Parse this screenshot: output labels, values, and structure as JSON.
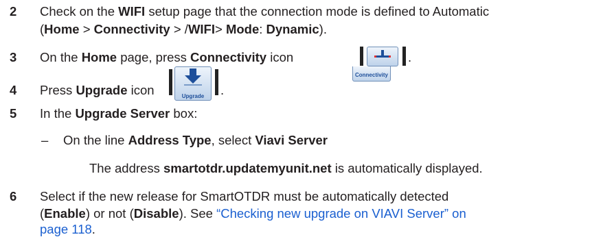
{
  "steps": [
    {
      "num": "2",
      "lines": [
        {
          "t1": "Check on the ",
          "b1": "WIFI",
          "t2": " setup page that the connection mode is defined to Automatic"
        },
        {
          "t1": "(",
          "b1": "Home",
          "t2": " > ",
          "b2": "Connectivity",
          "t3": " > /",
          "b3": "WIFI",
          "t4": "> ",
          "b4": "Mode",
          "t5": ": ",
          "b5": "Dynamic",
          "t6": ")."
        }
      ]
    },
    {
      "num": "3",
      "t1": "On the ",
      "b1": "Home",
      "t2": " page, press ",
      "b2": "Connectivity",
      "t3": " icon",
      "tail": "."
    },
    {
      "num": "4",
      "t1": "Press ",
      "b1": "Upgrade",
      "t2": " icon",
      "tail": "."
    },
    {
      "num": "5",
      "t1": "In the ",
      "b1": "Upgrade Server",
      "t2": " box:"
    },
    {
      "dash": "–",
      "t1": "On the line ",
      "b1": "Address Type",
      "t2": ", select ",
      "b2": "Viavi Server"
    },
    {
      "t1": "The address ",
      "b1": "smartotdr.updatemyunit.net",
      "t2": " is automatically displayed."
    },
    {
      "num": "6",
      "lines": [
        {
          "t1": "Select if the new release for SmartOTDR must be automatically detected"
        },
        {
          "t1": "(",
          "b1": "Enable",
          "t2": ") or not (",
          "b2": "Disable",
          "t3": "). See ",
          "link": "“Checking new upgrade on VIAVI Server” on"
        },
        {
          "link": "page 118",
          "t1": "."
        }
      ]
    }
  ],
  "icons": {
    "connectivity": {
      "caption": "Connectivity",
      "icon": "connectivity-icon"
    },
    "upgrade": {
      "caption": "Upgrade",
      "icon": "upgrade-arrow-icon"
    }
  },
  "colors": {
    "text": "#231f20",
    "link": "#1a5fd0",
    "icon_caption": "#1e4f9a"
  }
}
